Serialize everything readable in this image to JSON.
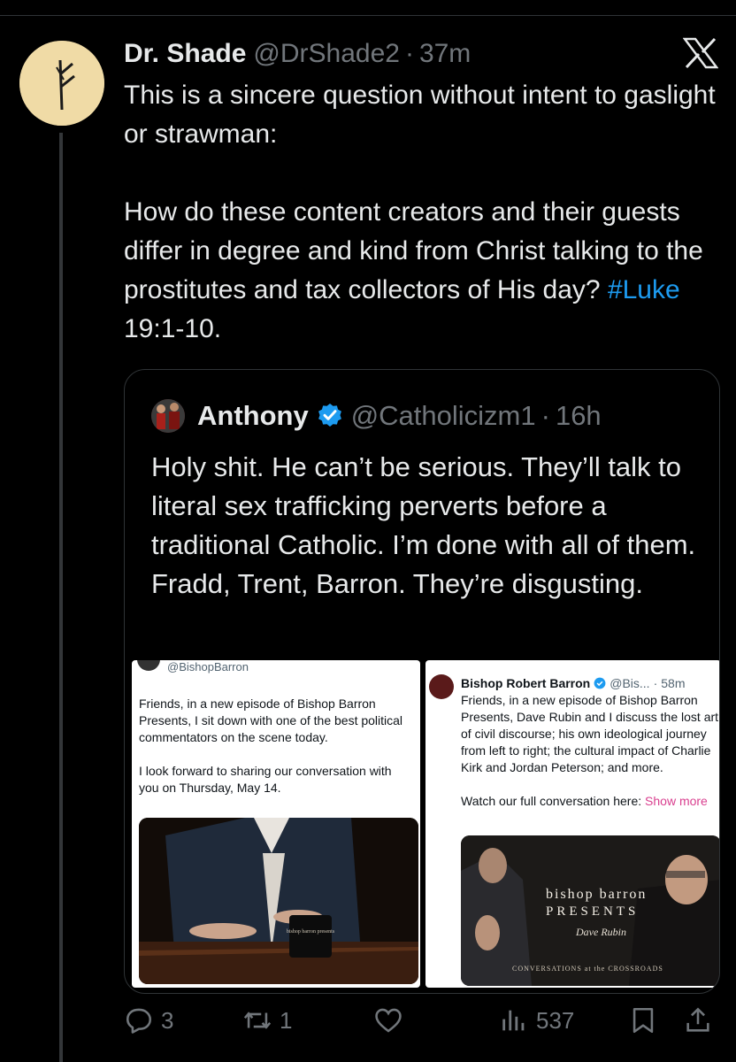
{
  "tweet": {
    "name": "Dr. Shade",
    "handle": "@DrShade2",
    "dot": "·",
    "time": "37m",
    "paragraph1": "This is a sincere question without intent to gaslight or strawman:",
    "paragraph2_before": "How do these content creators and their guests differ in degree and kind from Christ talking to the prostitutes and tax collectors of His day? ",
    "hashtag": "#Luke",
    "paragraph2_after": " 19:1-10."
  },
  "quote": {
    "name": "Anthony",
    "handle": "@Catholicizm1",
    "dot": "·",
    "time": "16h",
    "text": "Holy shit. He can’t be serious. They’ll talk to literal sex trafficking perverts before a traditional Catholic. I’m done with all of them. Fradd, Trent, Barron. They’re disgusting."
  },
  "embedded_left": {
    "handle": "@BishopBarron",
    "paragraph1": "Friends, in a new episode of Bishop Barron Presents, I sit down with one of the best political commentators on the scene today.",
    "paragraph2": "I look forward to sharing our conversation with you on Thursday, May 14.",
    "mug_text": "bishop barron presents"
  },
  "embedded_right": {
    "name": "Bishop Robert Barron",
    "handle": "@Bis...",
    "dot": "·",
    "time": "58m",
    "paragraph1": "Friends, in a new episode of Bishop Barron Presents, Dave Rubin and I discuss the lost art of civil discourse; his own ideological journey from left to right; the cultural impact of Charlie Kirk and Jordan Peterson; and more.",
    "paragraph2_before": "Watch our full conversation here: ",
    "show_more": "Show more",
    "image_title": "bishop barron",
    "image_presents": "PRESENTS",
    "image_guest": "Dave Rubin",
    "image_footer": "CONVERSATIONS at the CROSSROADS"
  },
  "actions": {
    "replies": "3",
    "reposts": "1",
    "likes": "",
    "views": "537"
  },
  "icons": {
    "close": "x-logo-icon",
    "reply": "reply-icon",
    "repost": "repost-icon",
    "like": "heart-icon",
    "views": "views-icon",
    "bookmark": "bookmark-icon",
    "share": "share-icon",
    "verified": "verified-badge-icon"
  },
  "colors": {
    "background": "#000000",
    "text": "#e7e9ea",
    "muted": "#71767b",
    "link": "#1d9bf0",
    "verified": "#1d9bf0",
    "avatar": "#f0dba6"
  }
}
